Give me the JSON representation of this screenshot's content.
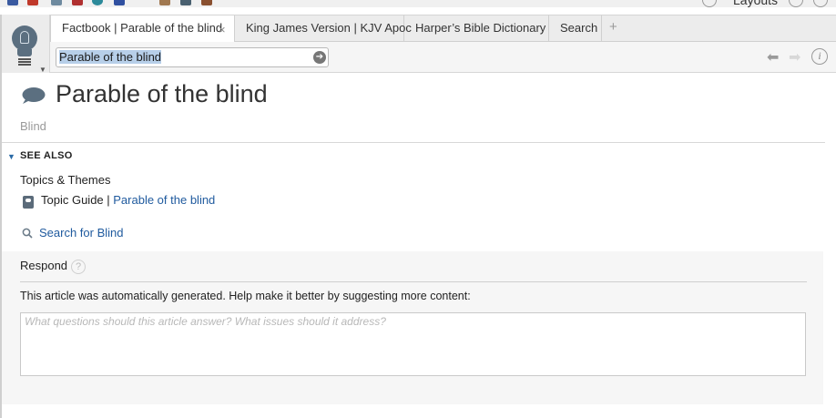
{
  "app_strip": {
    "layouts_label": "Layouts",
    "toolbar_colors": [
      "#3a5aa0",
      "#c0392b",
      "#6e8a9f",
      "#b03030",
      "#2c8a9a",
      "#3050a0",
      "#a07850",
      "#4a6070",
      "#8a5030"
    ]
  },
  "tabs": [
    {
      "label": "Factbook | Parable of the blind",
      "active": true
    },
    {
      "label": "King James Version | KJV Apoc",
      "active": false
    },
    {
      "label": "Harper’s Bible Dictionary",
      "active": false
    },
    {
      "label": "Search",
      "active": false
    }
  ],
  "tab_controls": {
    "close_glyph": "×",
    "add_glyph": "+"
  },
  "search": {
    "value": "Parable of the blind",
    "go_glyph": "➔"
  },
  "nav": {
    "back_glyph": "⬅",
    "forward_glyph": "➡",
    "info_glyph": "i"
  },
  "article": {
    "title": "Parable of the blind",
    "subtitle": "Blind",
    "see_also": {
      "heading": "SEE ALSO",
      "group_heading": "Topics & Themes",
      "guide_prefix": "Topic Guide |",
      "guide_link": "Parable of the blind"
    },
    "search_link": "Search for Blind"
  },
  "respond": {
    "title": "Respond",
    "help_glyph": "?",
    "notice": "This article was automatically generated. Help make it better by suggesting more content:",
    "placeholder": "What questions should this article answer? What issues should it address?"
  },
  "colors": {
    "link": "#1f5a9e",
    "accent_caret": "#2a6aa6",
    "icon_slate": "#5b6f80"
  }
}
